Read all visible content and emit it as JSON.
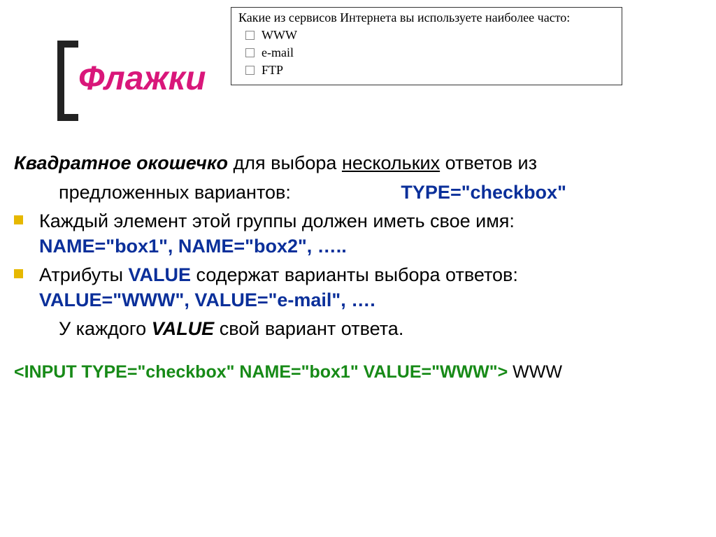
{
  "title": "Флажки",
  "example": {
    "question": "Какие из сервисов Интернета вы используете наиболее часто:",
    "options": [
      "WWW",
      "e-mail",
      "FTP"
    ]
  },
  "para1": {
    "lead": "Квадратное окошечко",
    "rest1": " для выбора ",
    "under": "нескольких",
    "rest2": " ответов из",
    "line2_indent": "предложенных вариантов:",
    "type_code": "TYPE=\"checkbox\""
  },
  "bullet1": {
    "text": "Каждый элемент этой группы должен иметь свое имя:",
    "code": "NAME=\"box1\",  NAME=\"box2\",    ….."
  },
  "bullet2": {
    "pre": "Атрибуты ",
    "val1": "VALUE",
    "mid": " содержат варианты выбора ответов:",
    "code": "VALUE=\"WWW\", VALUE=\"e-mail\", …."
  },
  "summary": {
    "pre": "У каждого ",
    "val": "VALUE",
    "post": " свой вариант ответа."
  },
  "code_example": {
    "code": "<INPUT   TYPE=\"checkbox\"  NAME=\"box1\"  VALUE=\"WWW\">",
    "trail": " WWW"
  }
}
